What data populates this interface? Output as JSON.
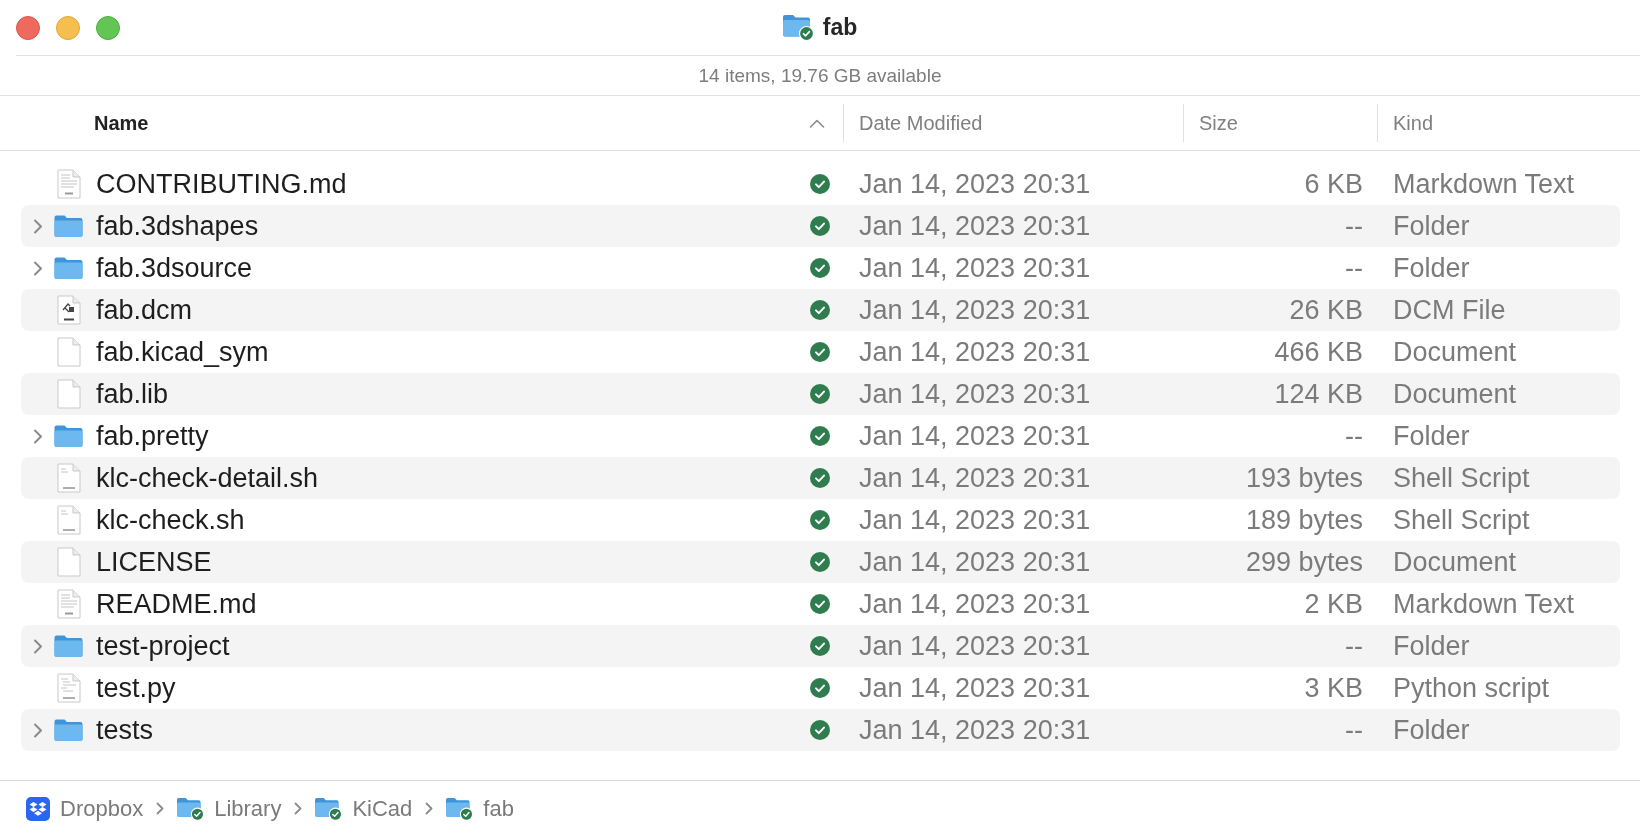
{
  "window": {
    "title": "fab",
    "title_synced": true
  },
  "status": "14 items, 19.76 GB available",
  "columns": [
    {
      "label": "Name",
      "sorted": true
    },
    {
      "label": "Date Modified",
      "sorted": false
    },
    {
      "label": "Size",
      "sorted": false
    },
    {
      "label": "Kind",
      "sorted": false
    }
  ],
  "rows": [
    {
      "name": "CONTRIBUTING.md",
      "kind": "markdown",
      "synced": true,
      "date_modified": "Jan 14, 2023 20:31",
      "size": "6 KB",
      "kind_text": "Markdown Text"
    },
    {
      "name": "fab.3dshapes",
      "kind": "folder",
      "expanded": false,
      "synced": true,
      "date_modified": "Jan 14, 2023 20:31",
      "size": "--",
      "kind_text": "Folder"
    },
    {
      "name": "fab.3dsource",
      "kind": "folder",
      "expanded": false,
      "synced": true,
      "date_modified": "Jan 14, 2023 20:31",
      "size": "--",
      "kind_text": "Folder"
    },
    {
      "name": "fab.dcm",
      "kind": "dcm",
      "synced": true,
      "date_modified": "Jan 14, 2023 20:31",
      "size": "26 KB",
      "kind_text": "DCM File"
    },
    {
      "name": "fab.kicad_sym",
      "kind": "blank",
      "synced": true,
      "date_modified": "Jan 14, 2023 20:31",
      "size": "466 KB",
      "kind_text": "Document"
    },
    {
      "name": "fab.lib",
      "kind": "blank",
      "synced": true,
      "date_modified": "Jan 14, 2023 20:31",
      "size": "124 KB",
      "kind_text": "Document"
    },
    {
      "name": "fab.pretty",
      "kind": "folder",
      "expanded": false,
      "synced": true,
      "date_modified": "Jan 14, 2023 20:31",
      "size": "--",
      "kind_text": "Folder"
    },
    {
      "name": "klc-check-detail.sh",
      "kind": "shell",
      "synced": true,
      "date_modified": "Jan 14, 2023 20:31",
      "size": "193 bytes",
      "kind_text": "Shell Script"
    },
    {
      "name": "klc-check.sh",
      "kind": "shell",
      "synced": true,
      "date_modified": "Jan 14, 2023 20:31",
      "size": "189 bytes",
      "kind_text": "Shell Script"
    },
    {
      "name": "LICENSE",
      "kind": "blank",
      "synced": true,
      "date_modified": "Jan 14, 2023 20:31",
      "size": "299 bytes",
      "kind_text": "Document"
    },
    {
      "name": "README.md",
      "kind": "markdown",
      "synced": true,
      "date_modified": "Jan 14, 2023 20:31",
      "size": "2 KB",
      "kind_text": "Markdown Text"
    },
    {
      "name": "test-project",
      "kind": "folder",
      "expanded": false,
      "synced": true,
      "date_modified": "Jan 14, 2023 20:31",
      "size": "--",
      "kind_text": "Folder"
    },
    {
      "name": "test.py",
      "kind": "python",
      "synced": true,
      "date_modified": "Jan 14, 2023 20:31",
      "size": "3 KB",
      "kind_text": "Python script"
    },
    {
      "name": "tests",
      "kind": "folder",
      "expanded": false,
      "synced": true,
      "date_modified": "Jan 14, 2023 20:31",
      "size": "--",
      "kind_text": "Folder"
    }
  ],
  "path": [
    {
      "label": "Dropbox",
      "kind": "dropbox"
    },
    {
      "label": "Library",
      "kind": "folder",
      "synced": true
    },
    {
      "label": "KiCad",
      "kind": "folder",
      "synced": true
    },
    {
      "label": "fab",
      "kind": "folder",
      "synced": true
    }
  ]
}
